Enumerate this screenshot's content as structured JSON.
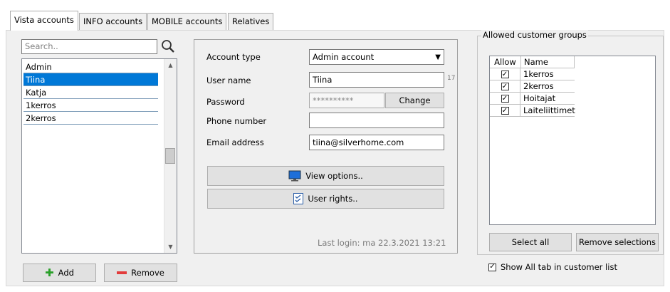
{
  "tabs": [
    {
      "label": "Vista accounts"
    },
    {
      "label": "INFO accounts"
    },
    {
      "label": "MOBILE accounts"
    },
    {
      "label": "Relatives"
    }
  ],
  "search": {
    "placeholder": "Search.."
  },
  "accounts": [
    "Admin",
    "Tiina",
    "Katja",
    "1kerros",
    "2kerros"
  ],
  "selected_account": "Tiina",
  "buttons": {
    "add": "Add",
    "remove": "Remove",
    "change": "Change",
    "view_options": "View options..",
    "user_rights": "User rights..",
    "select_all": "Select all",
    "remove_selections": "Remove selections"
  },
  "form": {
    "account_type_label": "Account type",
    "account_type_value": "Admin account",
    "user_name_label": "User name",
    "user_name_value": "Tiina",
    "user_name_count": "17",
    "password_label": "Password",
    "password_value": "**********",
    "phone_label": "Phone number",
    "phone_value": "",
    "email_label": "Email address",
    "email_value": "tiina@silverhome.com",
    "last_login": "Last login: ma 22.3.2021 13:21"
  },
  "groups": {
    "title": "Allowed customer groups",
    "col_allow": "Allow",
    "col_name": "Name",
    "rows": [
      {
        "name": "1kerros",
        "allowed": true
      },
      {
        "name": "2kerros",
        "allowed": true
      },
      {
        "name": "Hoitajat",
        "allowed": true
      },
      {
        "name": "Laiteliittimet",
        "allowed": true
      }
    ],
    "show_all_label": "Show All tab in customer list",
    "show_all_checked": true
  },
  "colors": {
    "selection": "#0078d7",
    "panel": "#f0f0f0"
  }
}
